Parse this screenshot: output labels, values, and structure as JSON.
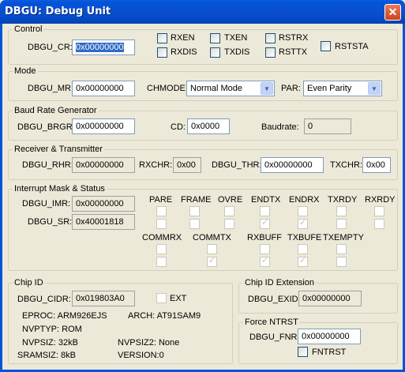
{
  "window": {
    "title": "DBGU: Debug Unit",
    "close_glyph": "✕"
  },
  "control": {
    "legend": "Control",
    "cr_label": "DBGU_CR:",
    "cr_value": "0x00000000",
    "checks": [
      "RXEN",
      "TXEN",
      "RSTRX",
      "RXDIS",
      "TXDIS",
      "RSTTX",
      "RSTSTA"
    ]
  },
  "mode": {
    "legend": "Mode",
    "mr_label": "DBGU_MR:",
    "mr_value": "0x00000000",
    "chmode_label": "CHMODE:",
    "chmode_value": "Normal Mode",
    "par_label": "PAR:",
    "par_value": "Even Parity"
  },
  "baud": {
    "legend": "Baud Rate Generator",
    "brgr_label": "DBGU_BRGR:",
    "brgr_value": "0x00000000",
    "cd_label": "CD:",
    "cd_value": "0x0000",
    "baudrate_label": "Baudrate:",
    "baudrate_value": "0"
  },
  "rxtx": {
    "legend": "Receiver & Transmitter",
    "rhr_label": "DBGU_RHR:",
    "rhr_value": "0x00000000",
    "rxchr_label": "RXCHR:",
    "rxchr_value": "0x00",
    "thr_label": "DBGU_THR:",
    "thr_value": "0x00000000",
    "txchr_label": "TXCHR:",
    "txchr_value": "0x00"
  },
  "interrupt": {
    "legend": "Interrupt Mask & Status",
    "imr_label": "DBGU_IMR:",
    "imr_value": "0x00000000",
    "sr_label": "DBGU_SR:",
    "sr_value": "0x40001818",
    "bits_row1": [
      {
        "name": "PARE",
        "sr_checked": false
      },
      {
        "name": "FRAME",
        "sr_checked": false
      },
      {
        "name": "OVRE",
        "sr_checked": false
      },
      {
        "name": "ENDTX",
        "sr_checked": true
      },
      {
        "name": "ENDRX",
        "sr_checked": true
      },
      {
        "name": "TXRDY",
        "sr_checked": false
      },
      {
        "name": "RXRDY",
        "sr_checked": false
      }
    ],
    "bits_row2": [
      {
        "name": "COMMRX",
        "sr_checked": false
      },
      {
        "name": "COMMTX",
        "sr_checked": true
      },
      {
        "name": "RXBUFF",
        "sr_checked": true
      },
      {
        "name": "TXBUFE",
        "sr_checked": true
      },
      {
        "name": "TXEMPTY",
        "sr_checked": false
      }
    ]
  },
  "chipid": {
    "legend": "Chip ID",
    "cidr_label": "DBGU_CIDR:",
    "cidr_value": "0x019803A0",
    "ext_label": "EXT",
    "eproc": "EPROC:  ARM926EJS",
    "arch": "ARCH:  AT91SAM9",
    "nvptyp": "NVPTYP: ROM",
    "nvpsiz": "NVPSIZ:  32kB",
    "nvpsiz2": "NVPSIZ2: None",
    "sramsiz": "SRAMSIZ:  8kB",
    "version": "VERSION:0"
  },
  "chipid_ext": {
    "legend": "Chip ID Extension",
    "exid_label": "DBGU_EXID:",
    "exid_value": "0x00000000"
  },
  "ntrst": {
    "legend": "Force NTRST",
    "fnr_label": "DBGU_FNR:",
    "fnr_value": "0x00000000",
    "fntrst_label": "FNTRST"
  }
}
